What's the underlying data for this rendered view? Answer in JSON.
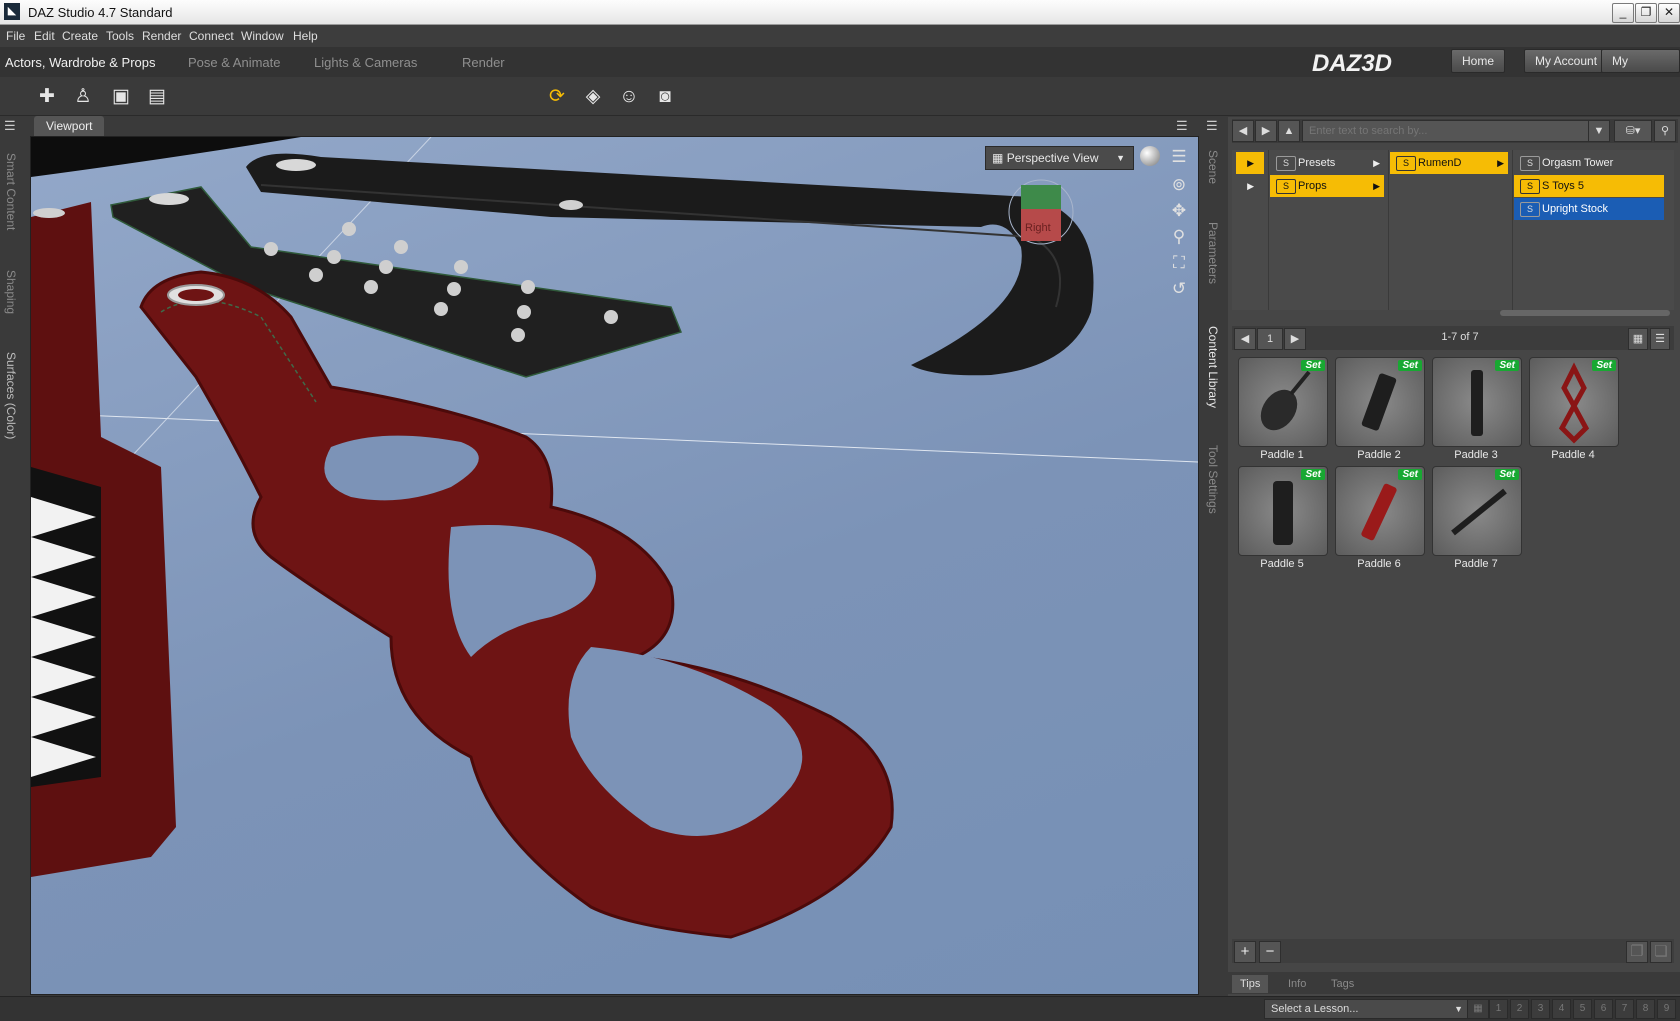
{
  "window": {
    "title": "DAZ Studio 4.7 Standard",
    "controls": {
      "minimize": "_",
      "restore": "❐",
      "close": "✕"
    }
  },
  "menu": [
    "File",
    "Edit",
    "Create",
    "Tools",
    "Render",
    "Connect",
    "Window",
    "Help"
  ],
  "rooms": {
    "tabs": [
      "Actors, Wardrobe & Props",
      "Pose & Animate",
      "Lights & Cameras",
      "Render"
    ],
    "active": "Actors, Wardrobe & Props"
  },
  "brand": {
    "logo": "DAZ3D"
  },
  "header_buttons": [
    "Home",
    "My Account",
    "My Gallery"
  ],
  "left_tabs": [
    "Smart Content",
    "Shaping",
    "Surfaces (Color)"
  ],
  "viewport": {
    "tab_label": "Viewport",
    "view_select": "Perspective View",
    "cube_label": "Right"
  },
  "right_tabs": [
    "Scene",
    "Parameters",
    "Content Library",
    "Tool Settings"
  ],
  "content_library": {
    "search_placeholder": "Enter text to search by...",
    "tree": {
      "col1": [
        "Presets",
        "Props"
      ],
      "col2": [
        "RumenD"
      ],
      "col3": [
        "Orgasm Tower",
        "S Toys 5",
        "Upright Stock"
      ]
    },
    "page_number": "1",
    "page_info": "1-7 of 7",
    "badge_label": "Set",
    "items": [
      "Paddle 1",
      "Paddle 2",
      "Paddle 3",
      "Paddle 4",
      "Paddle 5",
      "Paddle 6",
      "Paddle 7"
    ],
    "add": "+",
    "remove": "−"
  },
  "info_tabs": [
    "Tips",
    "Info",
    "Tags"
  ],
  "status": {
    "lesson_placeholder": "Select a Lesson...",
    "pages": [
      "1",
      "2",
      "3",
      "4",
      "5",
      "6",
      "7",
      "8",
      "9"
    ]
  },
  "colors": {
    "selected_folder": "#f6bc05",
    "selected_item": "#1b5db4",
    "badge": "#18a832",
    "viewport_bg": "#7c93b7",
    "paddle_red": "#6e1414"
  }
}
